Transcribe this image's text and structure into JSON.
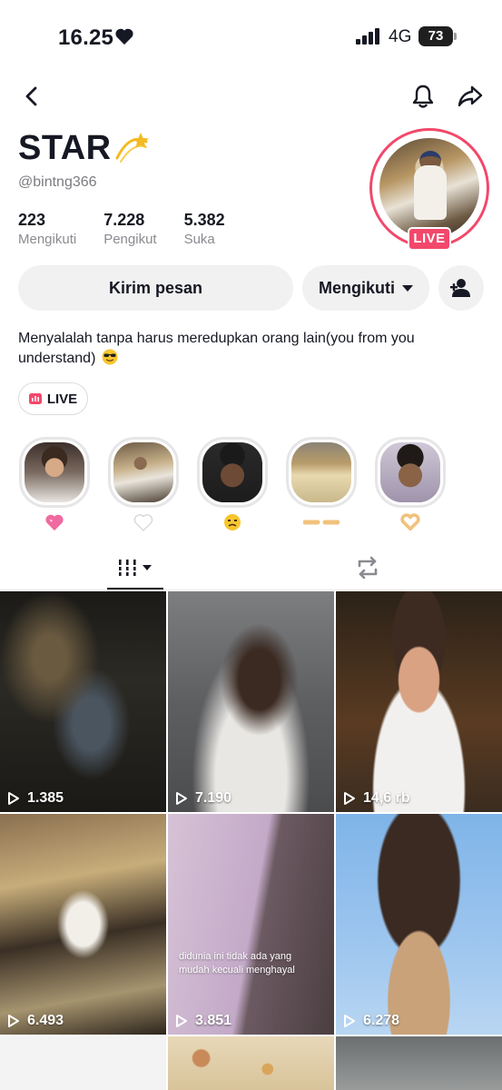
{
  "status_bar": {
    "time": "16.25",
    "network": "4G",
    "battery": "73"
  },
  "profile": {
    "name": "STAR",
    "username": "@bintng366",
    "live_badge": "LIVE",
    "stats": [
      {
        "value": "223",
        "label": "Mengikuti"
      },
      {
        "value": "7.228",
        "label": "Pengikut"
      },
      {
        "value": "5.382",
        "label": "Suka"
      }
    ],
    "bio": "Menyalalah tanpa harus meredupkan orang lain(you from you understand)"
  },
  "actions": {
    "message_label": "Kirim pesan",
    "following_label": "Mengikuti"
  },
  "live_chip": {
    "label": "LIVE"
  },
  "highlights": [
    {
      "emoji": "pink-heart"
    },
    {
      "emoji": "white-heart"
    },
    {
      "emoji": "pouting-face"
    },
    {
      "emoji": "pointing-fingers"
    },
    {
      "emoji": "heart-hands"
    }
  ],
  "videos": [
    {
      "views": "1.385"
    },
    {
      "views": "7.190"
    },
    {
      "views": "14,6 rb"
    },
    {
      "views": "6.493"
    },
    {
      "views": "3.851",
      "caption": "didunia ini tidak ada yang mudah kecuali menghayal"
    },
    {
      "views": "6.278"
    }
  ],
  "colors": {
    "accent": "#f2486b",
    "button_bg": "#f1f1f2",
    "text": "#161823"
  }
}
